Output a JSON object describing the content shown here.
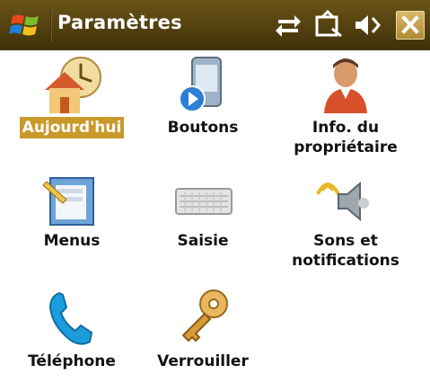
{
  "titlebar": {
    "title": "Paramètres",
    "start_icon": "windows-flag-icon",
    "status_icons": [
      "connectivity-icon",
      "sync-icon",
      "volume-icon"
    ],
    "close_icon": "close-icon"
  },
  "colors": {
    "titlebar": "#574410",
    "selection": "#c9992a",
    "close_button": "#c49a3f"
  },
  "items": [
    {
      "label": "Aujourd'hui",
      "icon": "today-house-clock-icon",
      "selected": true
    },
    {
      "label": "Boutons",
      "icon": "buttons-device-icon",
      "selected": false
    },
    {
      "label": "Info. du\npropriétaire",
      "icon": "owner-info-person-icon",
      "selected": false
    },
    {
      "label": "Menus",
      "icon": "menus-icon",
      "selected": false
    },
    {
      "label": "Saisie",
      "icon": "keyboard-icon",
      "selected": false
    },
    {
      "label": "Sons et\nnotifications",
      "icon": "sounds-speaker-icon",
      "selected": false
    },
    {
      "label": "Téléphone",
      "icon": "phone-handset-icon",
      "selected": false
    },
    {
      "label": "Verrouiller",
      "icon": "lock-key-icon",
      "selected": false
    }
  ]
}
